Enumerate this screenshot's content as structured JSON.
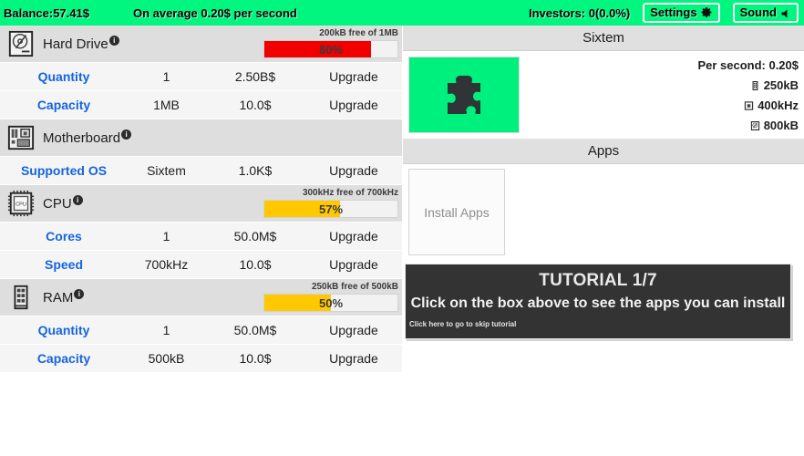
{
  "topbar": {
    "balance": "Balance:57.41$",
    "average": "On average 0.20$ per second",
    "investors": "Investors: 0(0.0%)",
    "settings_label": "Settings",
    "sound_label": "Sound",
    "background_color": "#00f67f"
  },
  "components": [
    {
      "name": "Hard Drive",
      "icon": "hard-drive-icon",
      "info_badge": "i",
      "bar": {
        "label": "200kB free of 1MB",
        "percent_text": "80%",
        "percent": 80,
        "color": "#f20000"
      },
      "rows": [
        {
          "label": "Quantity",
          "value": "1",
          "price": "2.50B$",
          "action": "Upgrade"
        },
        {
          "label": "Capacity",
          "value": "1MB",
          "price": "10.0$",
          "action": "Upgrade"
        }
      ]
    },
    {
      "name": "Motherboard",
      "icon": "motherboard-icon",
      "info_badge": "i",
      "bar": null,
      "rows": [
        {
          "label": "Supported OS",
          "value": "Sixtem",
          "price": "1.0K$",
          "action": "Upgrade"
        }
      ]
    },
    {
      "name": "CPU",
      "icon": "cpu-icon",
      "info_badge": "i",
      "bar": {
        "label": "300kHz free of 700kHz",
        "percent_text": "57%",
        "percent": 57,
        "color": "#ffc800"
      },
      "rows": [
        {
          "label": "Cores",
          "value": "1",
          "price": "50.0M$",
          "action": "Upgrade"
        },
        {
          "label": "Speed",
          "value": "700kHz",
          "price": "10.0$",
          "action": "Upgrade"
        }
      ]
    },
    {
      "name": "RAM",
      "icon": "ram-icon",
      "info_badge": "i",
      "bar": {
        "label": "250kB free of 500kB",
        "percent_text": "50%",
        "percent": 50,
        "color": "#ffc800"
      },
      "rows": [
        {
          "label": "Quantity",
          "value": "1",
          "price": "50.0M$",
          "action": "Upgrade"
        },
        {
          "label": "Capacity",
          "value": "500kB",
          "price": "10.0$",
          "action": "Upgrade"
        }
      ]
    }
  ],
  "os_panel": {
    "title": "Sixtem",
    "logo_icon": "puzzle-piece-icon",
    "logo_color": "#00f07d",
    "per_second": "Per second: 0.20$",
    "stats": [
      {
        "icon": "ram-stat-icon",
        "value": "250kB"
      },
      {
        "icon": "cpu-stat-icon",
        "value": "400kHz"
      },
      {
        "icon": "hdd-stat-icon",
        "value": "800kB"
      }
    ]
  },
  "apps_panel": {
    "title": "Apps",
    "install_label": "Install Apps"
  },
  "tutorial": {
    "title": "TUTORIAL 1/7",
    "message": "Click on the box above to see the apps you can install",
    "skip": "Click here to go to skip tutorial"
  }
}
